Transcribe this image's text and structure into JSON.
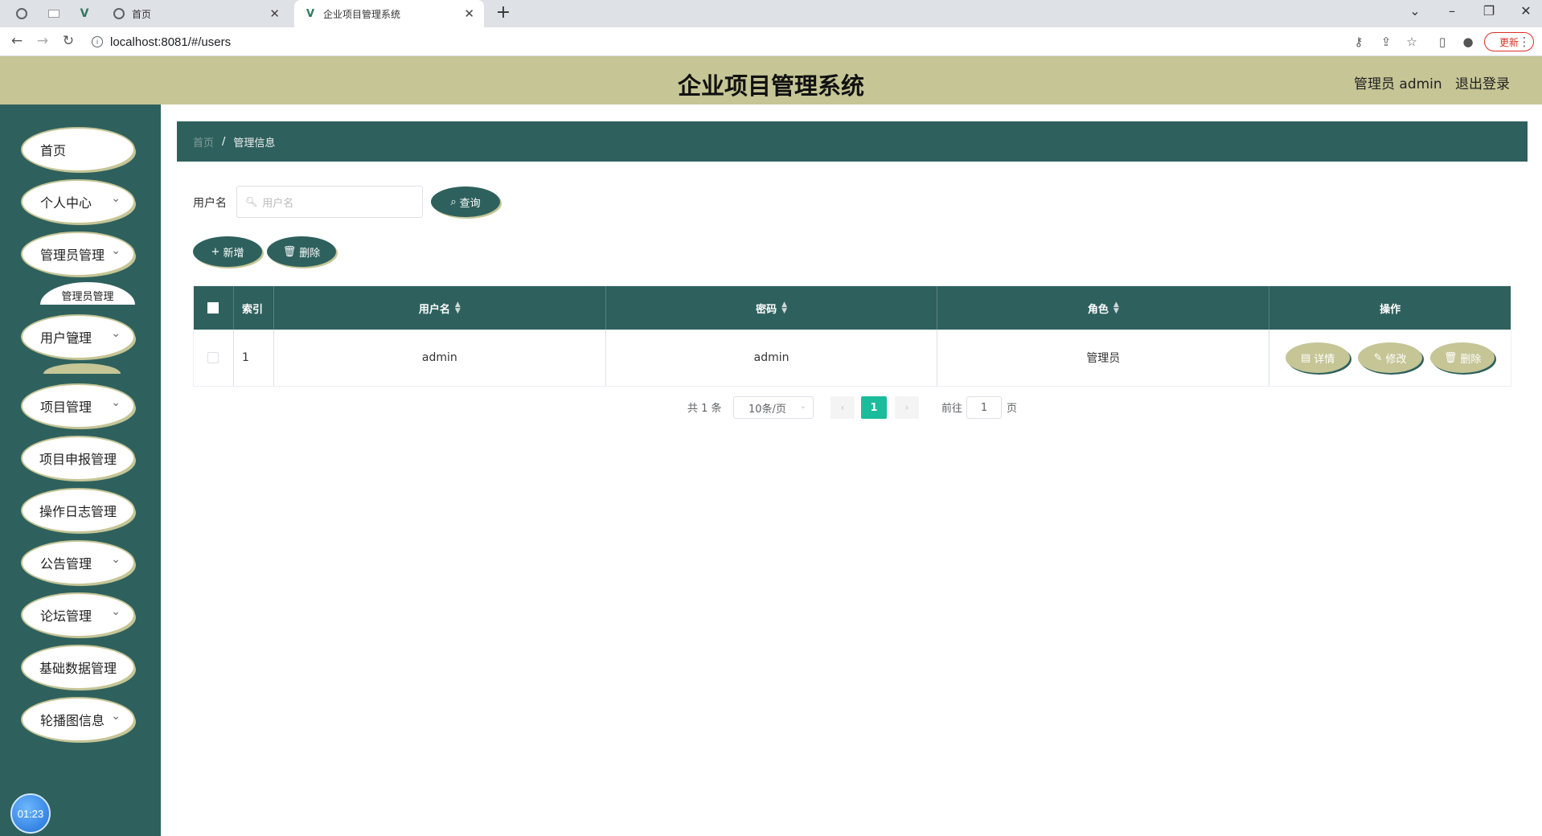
{
  "browser": {
    "tabs": [
      {
        "title": "首页",
        "icon": "globe-icon"
      },
      {
        "title": "企业项目管理系统",
        "icon": "vue-icon"
      }
    ],
    "url": "localhost:8081/#/users",
    "update_label": "更新"
  },
  "header": {
    "title": "企业项目管理系统",
    "user_role": "管理员 admin",
    "logout": "退出登录"
  },
  "sidebar": {
    "items": [
      {
        "label": "首页"
      },
      {
        "label": "个人中心"
      },
      {
        "label": "管理员管理"
      },
      {
        "label": "管理员管理"
      },
      {
        "label": "用户管理"
      },
      {
        "label": "项目管理"
      },
      {
        "label": "项目申报管理"
      },
      {
        "label": "操作日志管理"
      },
      {
        "label": "公告管理"
      },
      {
        "label": "论坛管理"
      },
      {
        "label": "基础数据管理"
      },
      {
        "label": "轮播图信息"
      }
    ],
    "clock": "01:23"
  },
  "breadcrumb": {
    "home": "首页",
    "separator": "/",
    "current": "管理信息"
  },
  "search": {
    "label": "用户名",
    "placeholder": "用户名",
    "button": "查询"
  },
  "actions": {
    "add": "新增",
    "delete": "删除"
  },
  "table": {
    "headers": [
      "索引",
      "用户名",
      "密码",
      "角色",
      "操作"
    ],
    "rows": [
      {
        "index": "1",
        "username": "admin",
        "password": "admin",
        "role": "管理员"
      }
    ],
    "row_actions": {
      "detail": "详情",
      "edit": "修改",
      "delete": "删除"
    }
  },
  "pagination": {
    "total": "共 1 条",
    "page_size": "10条/页",
    "current_page": "1",
    "goto_label": "前往",
    "goto_value": "1",
    "page_suffix": "页"
  }
}
